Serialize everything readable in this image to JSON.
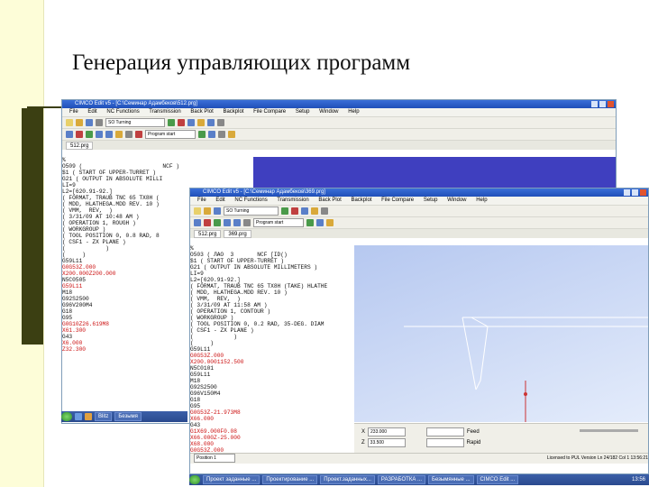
{
  "slide": {
    "title": "Генерация управляющих программ"
  },
  "back_window": {
    "title": "CIMCO Edit v5 - [C:\\Семинар Адамбеков\\512.prg]",
    "menu": [
      "File",
      "Edit",
      "NC Functions",
      "Transmission",
      "Back Plot",
      "Backplot",
      "File Compare",
      "Setup",
      "Window",
      "Help"
    ],
    "machine": "SO Turning",
    "tab": "512.prg",
    "program_start": "Program start",
    "code_lines": [
      {
        "t": "%",
        "r": false
      },
      {
        "t": "O509 (                        NCF )",
        "r": false
      },
      {
        "t": "$1 ( START OF UPPER-TURRET )",
        "r": false
      },
      {
        "t": "G21 ( OUTPUT IN ABSOLUTE MILLI",
        "r": false
      },
      {
        "t": "LI=9",
        "r": false
      },
      {
        "t": "L2=[620.91-92.]",
        "r": false
      },
      {
        "t": "( FORMAT, TRAUB TNC 65 TX8H (",
        "r": false
      },
      {
        "t": "( MDD, HLATHEGA.MDD REV. 10 )",
        "r": false
      },
      {
        "t": "( VMM,  REV,  )",
        "r": false
      },
      {
        "t": "( 3/31/09 AT 10:48 AM )",
        "r": false
      },
      {
        "t": "( OPERATION 1, ROUGH )",
        "r": false
      },
      {
        "t": "( WORKGROUP )",
        "r": false
      },
      {
        "t": "( TOOL POSITION 0, 0.8 RAD, 8",
        "r": false
      },
      {
        "t": "( CSF1 - ZX PLANE )",
        "r": false
      },
      {
        "t": "(            )",
        "r": false
      },
      {
        "t": "(     )",
        "r": false
      },
      {
        "t": "G59L11",
        "r": false
      },
      {
        "t": "G0G53Z.000",
        "r": true
      },
      {
        "t": "X200.000Z200.000",
        "r": true
      },
      {
        "t": "N5C0505",
        "r": false
      },
      {
        "t": "G59L11",
        "r": true
      },
      {
        "t": "M18",
        "r": false
      },
      {
        "t": "G92S2500",
        "r": false
      },
      {
        "t": "G96V200M4",
        "r": false
      },
      {
        "t": "G18",
        "r": false
      },
      {
        "t": "G95",
        "r": false
      },
      {
        "t": "G0G10Z26.619M8",
        "r": true
      },
      {
        "t": "X61.300",
        "r": true
      },
      {
        "t": "G43",
        "r": false
      },
      {
        "t": "X6.000",
        "r": true
      },
      {
        "t": "Z32.300",
        "r": true
      }
    ],
    "taskbar_items": [
      "",
      "",
      "",
      "",
      "Blitz",
      "Безымя",
      "",
      "",
      ""
    ]
  },
  "front_window": {
    "title": "CIMCO Edit v5 - [C:\\Семинар Адамбеков\\369.prg]",
    "menu": [
      "File",
      "Edit",
      "NC Functions",
      "Transmission",
      "Back Plot",
      "Backplot",
      "File Compare",
      "Setup",
      "Window",
      "Help"
    ],
    "machine": "SO Turning",
    "tabs": [
      "512.prg",
      "369.prg"
    ],
    "program_start": "Program start",
    "code_lines": [
      {
        "t": "%",
        "r": false
      },
      {
        "t": "O503 ( ЛАО  3       NCF [ID()",
        "r": false
      },
      {
        "t": "$1 ( START OF UPPER-TURRET )",
        "r": false
      },
      {
        "t": "G21 ( OUTPUT IN ABSOLUTE MILLIMETERS )",
        "r": false
      },
      {
        "t": "LI=9",
        "r": false
      },
      {
        "t": "L2=[620.91-92.]",
        "r": false
      },
      {
        "t": "( FORMAT, TRAUB TNC 65 TX8H (TAKE) HLATHE",
        "r": false
      },
      {
        "t": "( MDD, HLATHEGA.MDD REV. 10 )",
        "r": false
      },
      {
        "t": "( VMM,  REV,  )",
        "r": false
      },
      {
        "t": "( 3/31/09 AT 11:58 AM )",
        "r": false
      },
      {
        "t": "( OPERATION 1, CONTOUR )",
        "r": false
      },
      {
        "t": "( WORKGROUP )",
        "r": false
      },
      {
        "t": "( TOOL POSITION 0, 0.2 RAD, 35-DEG. DIAM",
        "r": false
      },
      {
        "t": "( CSF1 - ZX PLANE )",
        "r": false
      },
      {
        "t": "(            )",
        "r": false
      },
      {
        "t": "(     )",
        "r": false
      },
      {
        "t": "G59L11",
        "r": false
      },
      {
        "t": "G0G53Z.000",
        "r": true
      },
      {
        "t": "X200.0001152.500",
        "r": true
      },
      {
        "t": "N5C0101",
        "r": false
      },
      {
        "t": "G59L11",
        "r": false
      },
      {
        "t": "M18",
        "r": false
      },
      {
        "t": "G92S2500",
        "r": false
      },
      {
        "t": "G96V150M4",
        "r": false
      },
      {
        "t": "G18",
        "r": false
      },
      {
        "t": "G95",
        "r": false
      },
      {
        "t": "G0G53Z-21.973M8",
        "r": true
      },
      {
        "t": "X66.000",
        "r": true
      },
      {
        "t": "G43",
        "r": false
      },
      {
        "t": "G1X69.000F0.08",
        "r": true
      },
      {
        "t": "X66.000Z-25.000",
        "r": true
      },
      {
        "t": "X68.000",
        "r": true
      },
      {
        "t": "G0G53Z.000",
        "r": true
      }
    ],
    "fields": {
      "x_label": "X",
      "z_label": "Z",
      "x_value": "233.000",
      "z_value": "33.500",
      "feed_label": "Feed",
      "speed_label": "Rapid"
    },
    "position_label": "Position 1",
    "status_text": "Licensed to PUL Version   Ln 24/182  Col 1  13:56:21",
    "taskbar_items": [
      "",
      "Проект заданные  ...",
      "Проектирование ...",
      "Проект.заданных...",
      "РАЗРАБОТКА ...",
      "Безымянные ...",
      "CIMCO Edit ..."
    ],
    "clock": "13:56"
  },
  "colors": {
    "viewport_blue": "#3f3fbf",
    "viewport_light": "#b6c8f0",
    "code_red": "#cc1111"
  }
}
